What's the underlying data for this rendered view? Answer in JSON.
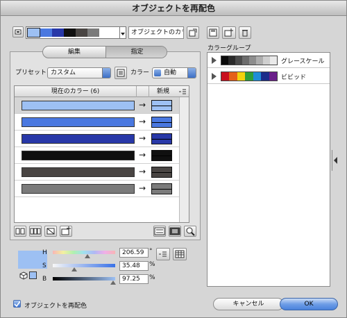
{
  "window": {
    "title": "オブジェクトを再配色"
  },
  "top": {
    "colors_field": "オブジェクトのカラー"
  },
  "right": {
    "heading": "カラーグループ",
    "groups": [
      {
        "label": "グレースケール",
        "colors": [
          "#0a0a0a",
          "#2a2a2a",
          "#4b4b4b",
          "#6c6c6c",
          "#8d8d8d",
          "#aeaeae",
          "#cfcfcf",
          "#eaeaea"
        ]
      },
      {
        "label": "ビビッド",
        "colors": [
          "#c8101f",
          "#e4601a",
          "#f2d20e",
          "#2e9e3a",
          "#1f8dd8",
          "#1c2d8a",
          "#6a1f8a"
        ]
      }
    ]
  },
  "tabs": {
    "edit": "編集",
    "assign": "指定"
  },
  "preset": {
    "label": "プリセット :",
    "value": "カスタム"
  },
  "color_opt": {
    "label": "カラー :",
    "value": "自動"
  },
  "table": {
    "col_current": "現在のカラー (6)",
    "col_new": "新規",
    "rows": [
      {
        "current": "#9dc0f3",
        "new": "#9dc0f3"
      },
      {
        "current": "#4a78e0",
        "new": "#4a78e0"
      },
      {
        "current": "#2838a8",
        "new": "#2838a8"
      },
      {
        "current": "#101010",
        "new": "#101010"
      },
      {
        "current": "#494543",
        "new": "#494543"
      },
      {
        "current": "#7b7b7b",
        "new": "#7b7b7b"
      }
    ]
  },
  "hsb": {
    "h_label": "H",
    "h_value": "206.59",
    "h_unit": "°",
    "s_label": "S",
    "s_value": "35.48",
    "s_unit": "%",
    "b_label": "B",
    "b_value": "97.25",
    "b_unit": "%",
    "swatch": "#9dc0f3"
  },
  "footer": {
    "recolor_label": "オブジェクトを再配色",
    "cancel": "キャンセル",
    "ok": "OK"
  },
  "colors": {
    "accent": "#3a72d0"
  }
}
